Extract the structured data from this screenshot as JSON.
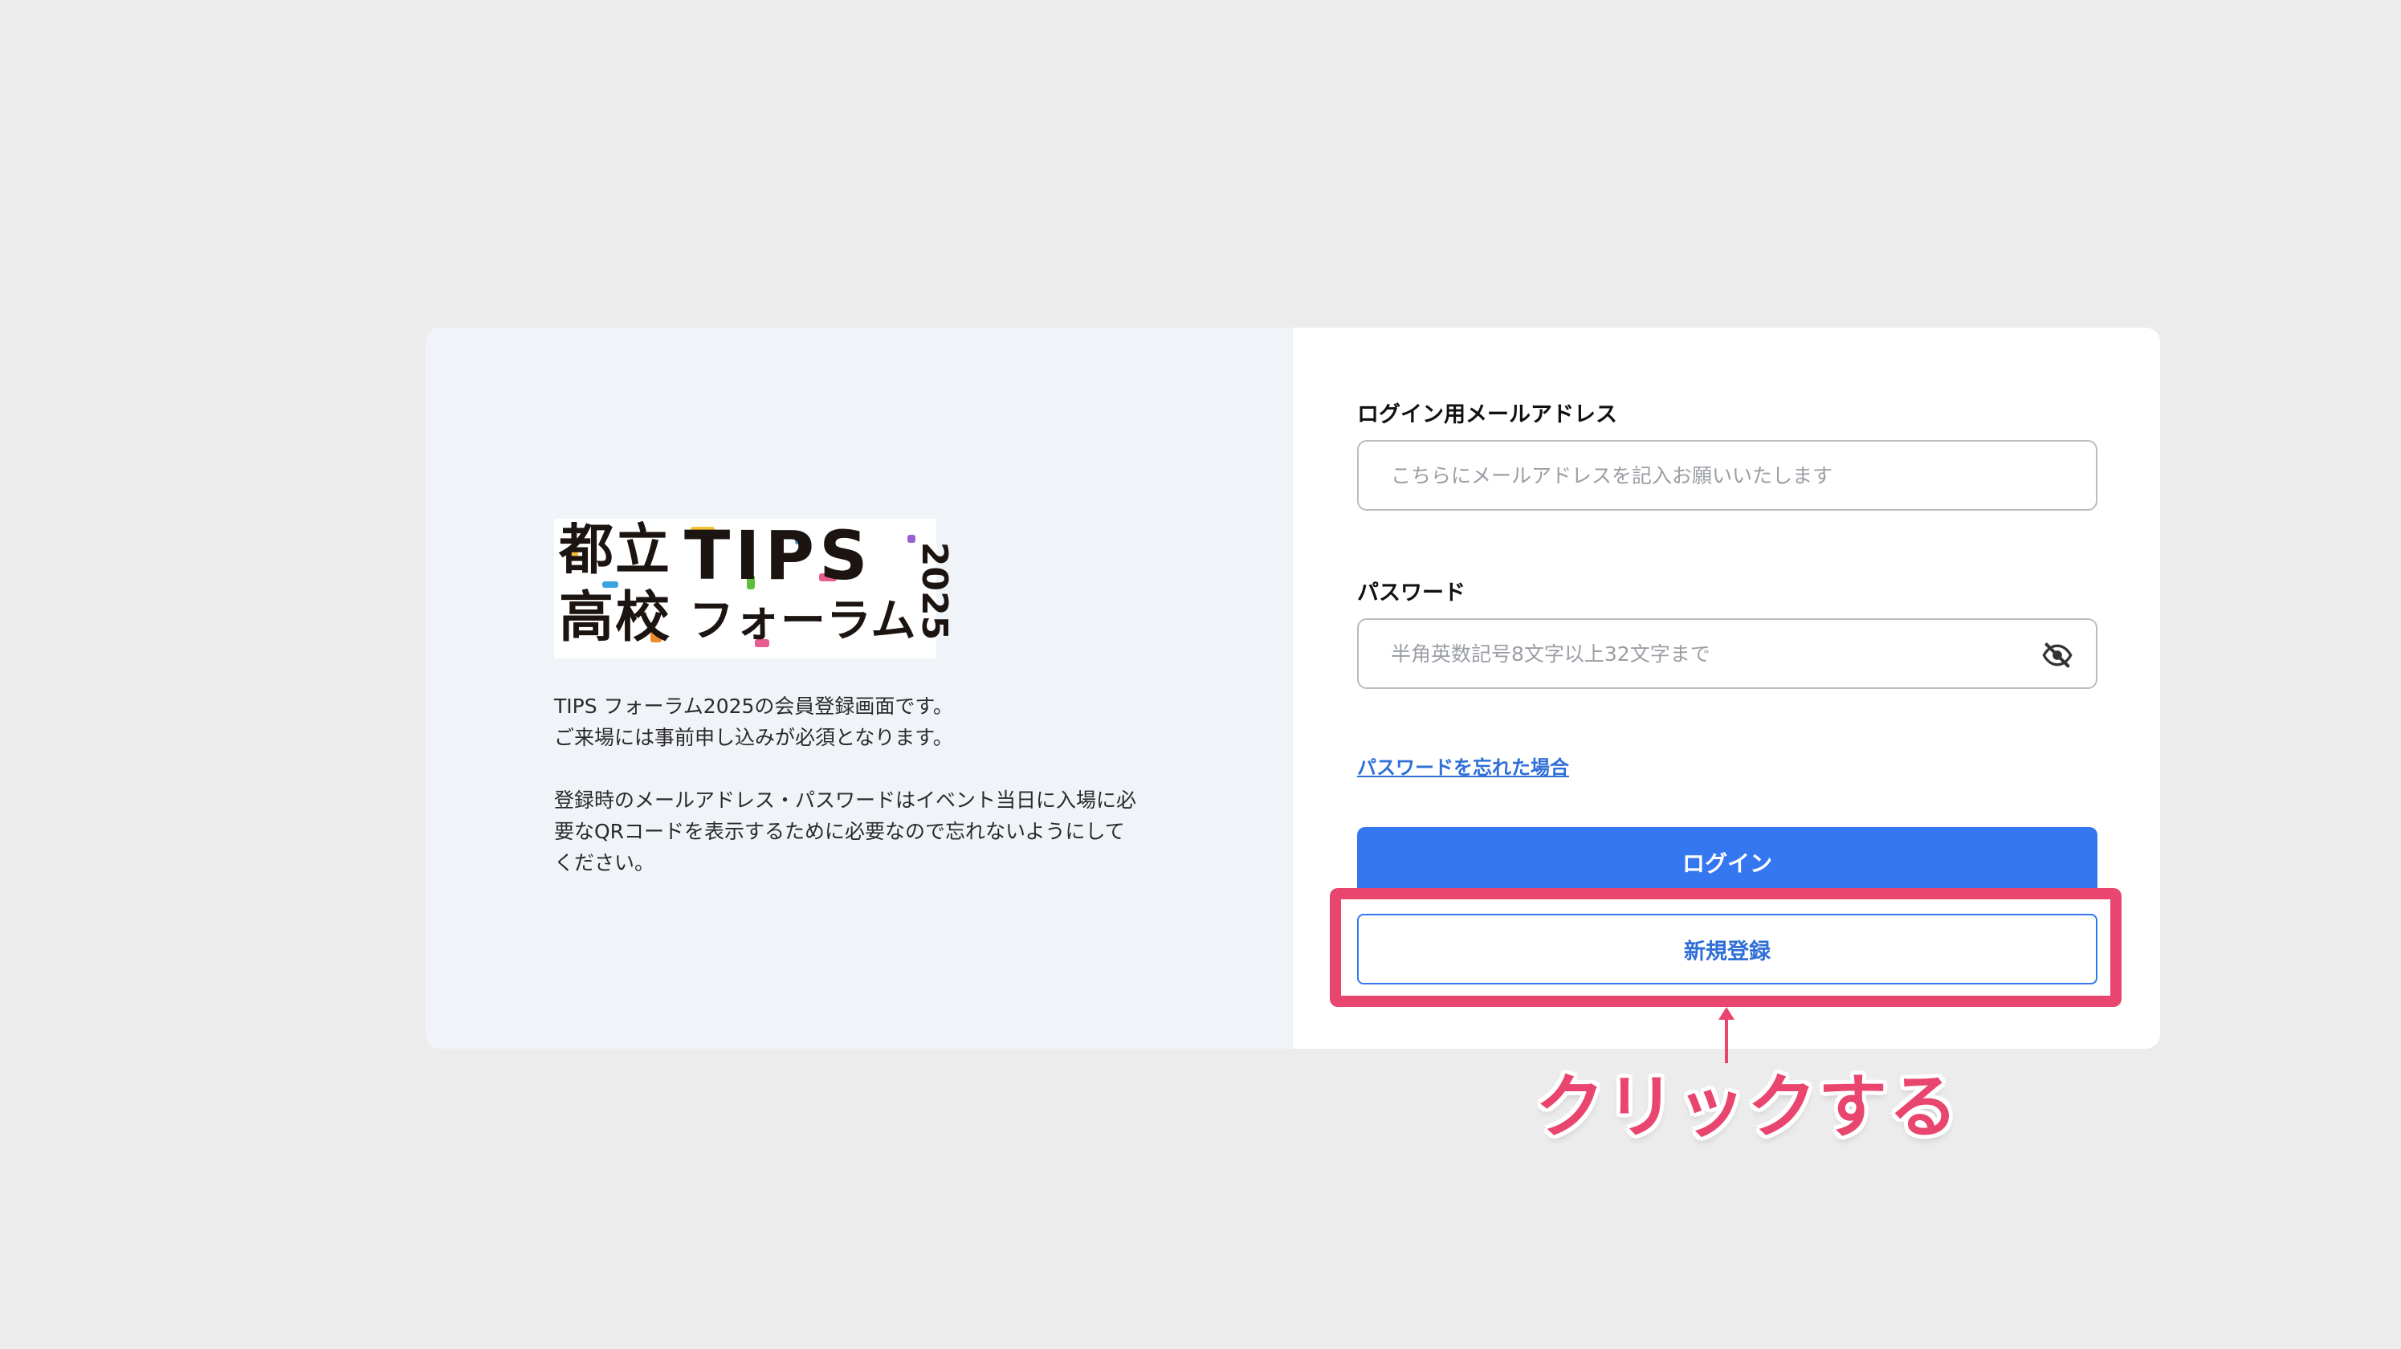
{
  "logo": {
    "kanji_top": "都立",
    "kanji_bottom": "高校",
    "tips": "TIPS",
    "forum": "フォーラム",
    "year": "2025"
  },
  "intro": {
    "line1": "TIPS フォーラム2025の会員登録画面です。",
    "line2": "ご来場には事前申し込みが必須となります。",
    "line3": "登録時のメールアドレス・パスワードはイベント当日に入場に必",
    "line4": "要なQRコードを表示するために必要なので忘れないようにして",
    "line5": "ください。"
  },
  "form": {
    "email_label": "ログイン用メールアドレス",
    "email_placeholder": "こちらにメールアドレスを記入お願いいたします",
    "email_value": "",
    "password_label": "パスワード",
    "password_placeholder": "半角英数記号8文字以上32文字まで",
    "password_value": "",
    "visibility_icon": "eye-off-icon",
    "forgot_link": "パスワードを忘れた場合",
    "login_button": "ログイン",
    "register_button": "新規登録"
  },
  "annotation": {
    "callout": "クリックする"
  },
  "colors": {
    "background": "#ececec",
    "left_panel": "#f0f3f8",
    "primary": "#3477f0",
    "link": "#2f6fd6",
    "highlight": "#e8466e"
  }
}
